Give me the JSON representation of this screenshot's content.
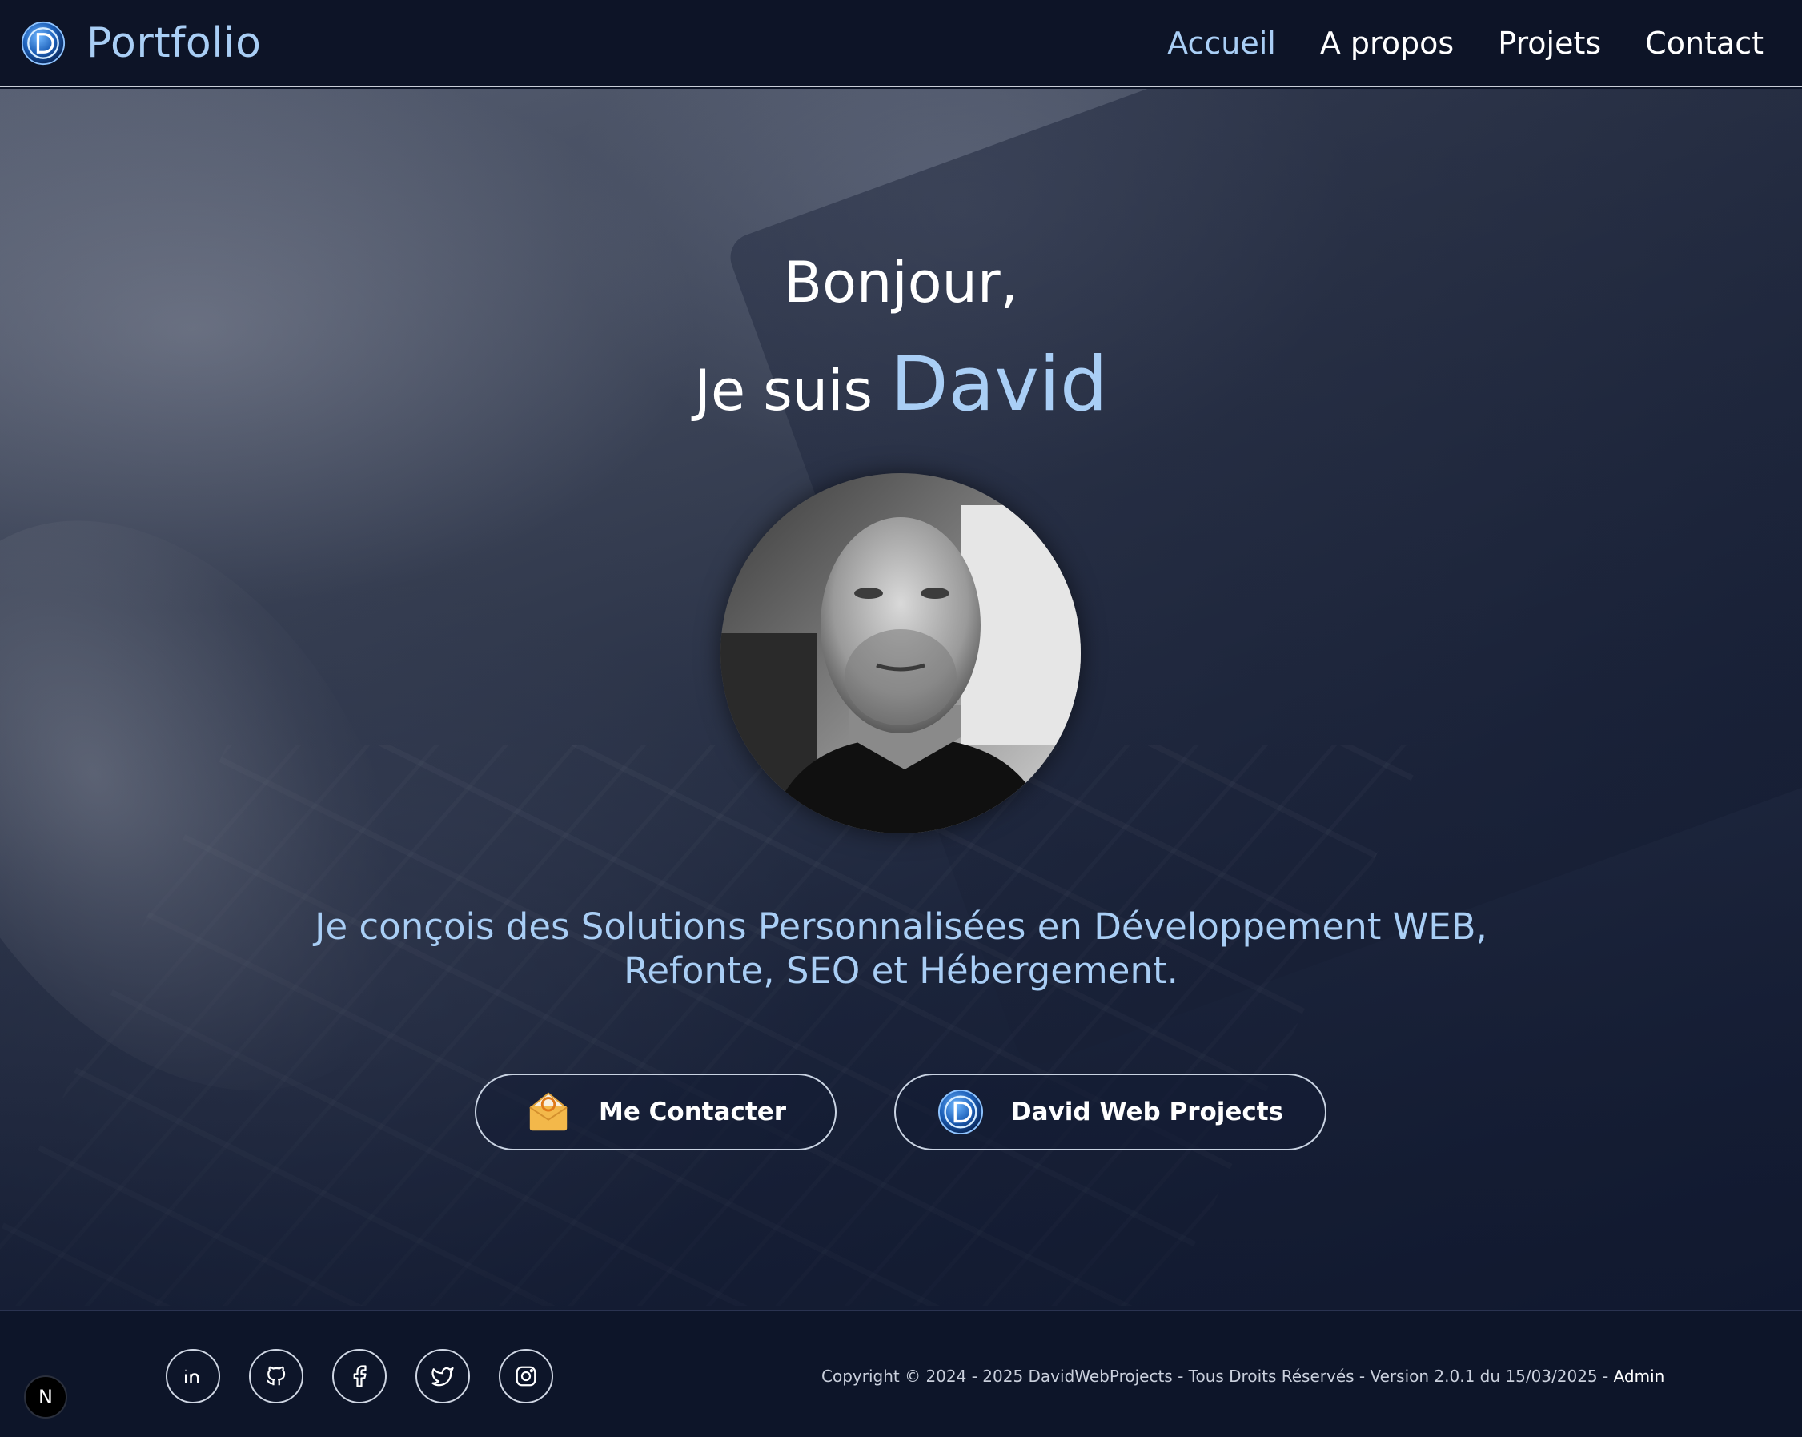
{
  "navbar": {
    "brand_title": "Portfolio",
    "links": [
      {
        "label": "Accueil",
        "active": true
      },
      {
        "label": "A propos"
      },
      {
        "label": "Projets"
      },
      {
        "label": "Contact"
      }
    ]
  },
  "hero": {
    "greeting_line1": "Bonjour,",
    "greeting_prefix": "Je suis",
    "name": "David",
    "tagline_line1": "Je conçois des Solutions Personnalisées en Développement WEB,",
    "tagline_line2": "Refonte, SEO et Hébergement.",
    "buttons": {
      "contact": {
        "label": "Me Contacter",
        "icon": "mail-envelope-icon"
      },
      "projects": {
        "label": "David Web Projects",
        "icon": "dwp-logo-icon"
      }
    }
  },
  "footer": {
    "socials": [
      "linkedin-icon",
      "github-icon",
      "facebook-icon",
      "twitter-icon",
      "instagram-icon"
    ],
    "copyright": "Copyright © 2024 - 2025 DavidWebProjects - Tous Droits Réservés - Version 2.0.1 du 15/03/2025 -",
    "admin_label": "Admin",
    "badge_label": "N"
  },
  "colors": {
    "accent": "#a9cef5",
    "nav_bg": "#0d1427",
    "footer_bg": "#0d1529"
  }
}
